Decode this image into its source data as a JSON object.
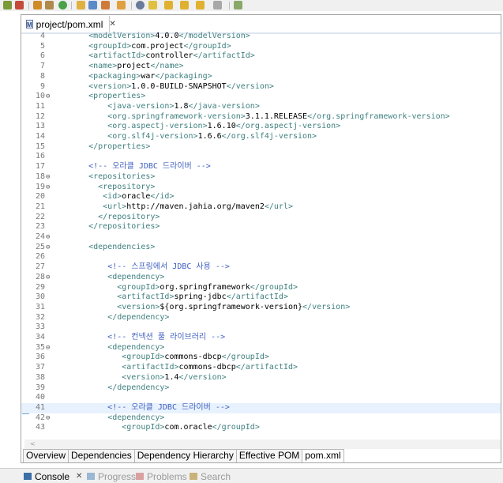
{
  "editor": {
    "tab_label": "project/pom.xml",
    "tab_close": "✕",
    "file_icon_glyph": "M"
  },
  "code_lines": [
    {
      "n": "4",
      "fold": "",
      "parts": [
        {
          "k": "t",
          "s": "<modelVersion>"
        },
        {
          "k": "x",
          "s": "4.0.0"
        },
        {
          "k": "t",
          "s": "</modelVersion>"
        }
      ],
      "indent": "    "
    },
    {
      "n": "5",
      "fold": "",
      "parts": [
        {
          "k": "t",
          "s": "<groupId>"
        },
        {
          "k": "x",
          "s": "com.project"
        },
        {
          "k": "t",
          "s": "</groupId>"
        }
      ],
      "indent": "    "
    },
    {
      "n": "6",
      "fold": "",
      "parts": [
        {
          "k": "t",
          "s": "<artifactId>"
        },
        {
          "k": "x",
          "s": "controller"
        },
        {
          "k": "t",
          "s": "</artifactId>"
        }
      ],
      "indent": "    "
    },
    {
      "n": "7",
      "fold": "",
      "parts": [
        {
          "k": "t",
          "s": "<name>"
        },
        {
          "k": "x",
          "s": "project"
        },
        {
          "k": "t",
          "s": "</name>"
        }
      ],
      "indent": "    "
    },
    {
      "n": "8",
      "fold": "",
      "parts": [
        {
          "k": "t",
          "s": "<packaging>"
        },
        {
          "k": "x",
          "s": "war"
        },
        {
          "k": "t",
          "s": "</packaging>"
        }
      ],
      "indent": "    "
    },
    {
      "n": "9",
      "fold": "",
      "parts": [
        {
          "k": "t",
          "s": "<version>"
        },
        {
          "k": "x",
          "s": "1.0.0-BUILD-SNAPSHOT"
        },
        {
          "k": "t",
          "s": "</version>"
        }
      ],
      "indent": "    "
    },
    {
      "n": "10",
      "fold": "⊖",
      "parts": [
        {
          "k": "t",
          "s": "<properties>"
        }
      ],
      "indent": "    "
    },
    {
      "n": "11",
      "fold": "",
      "parts": [
        {
          "k": "t",
          "s": "<java-version>"
        },
        {
          "k": "x",
          "s": "1.8"
        },
        {
          "k": "t",
          "s": "</java-version>"
        }
      ],
      "indent": "        "
    },
    {
      "n": "12",
      "fold": "",
      "parts": [
        {
          "k": "t",
          "s": "<org.springframework-version>"
        },
        {
          "k": "x",
          "s": "3.1.1.RELEASE"
        },
        {
          "k": "t",
          "s": "</org.springframework-version>"
        }
      ],
      "indent": "        "
    },
    {
      "n": "13",
      "fold": "",
      "parts": [
        {
          "k": "t",
          "s": "<org.aspectj-version>"
        },
        {
          "k": "x",
          "s": "1.6.10"
        },
        {
          "k": "t",
          "s": "</org.aspectj-version>"
        }
      ],
      "indent": "        "
    },
    {
      "n": "14",
      "fold": "",
      "parts": [
        {
          "k": "t",
          "s": "<org.slf4j-version>"
        },
        {
          "k": "x",
          "s": "1.6.6"
        },
        {
          "k": "t",
          "s": "</org.slf4j-version>"
        }
      ],
      "indent": "        "
    },
    {
      "n": "15",
      "fold": "",
      "parts": [
        {
          "k": "t",
          "s": "</properties>"
        }
      ],
      "indent": "    "
    },
    {
      "n": "16",
      "fold": "",
      "parts": [],
      "indent": ""
    },
    {
      "n": "17",
      "fold": "",
      "parts": [
        {
          "k": "c",
          "s": "<!-- 오라클 JDBC 드라이버 -->"
        }
      ],
      "indent": "    "
    },
    {
      "n": "18",
      "fold": "⊖",
      "parts": [
        {
          "k": "t",
          "s": "<repositories>"
        }
      ],
      "indent": "    "
    },
    {
      "n": "19",
      "fold": "⊖",
      "parts": [
        {
          "k": "t",
          "s": "<repository>"
        }
      ],
      "indent": "      "
    },
    {
      "n": "20",
      "fold": "",
      "parts": [
        {
          "k": "t",
          "s": "<id>"
        },
        {
          "k": "x",
          "s": "oracle"
        },
        {
          "k": "t",
          "s": "</id>"
        }
      ],
      "indent": "       "
    },
    {
      "n": "21",
      "fold": "",
      "parts": [
        {
          "k": "t",
          "s": "<url>"
        },
        {
          "k": "x",
          "s": "http://maven.jahia.org/maven2"
        },
        {
          "k": "t",
          "s": "</url>"
        }
      ],
      "indent": "       "
    },
    {
      "n": "22",
      "fold": "",
      "parts": [
        {
          "k": "t",
          "s": "</repository>"
        }
      ],
      "indent": "      "
    },
    {
      "n": "23",
      "fold": "",
      "parts": [
        {
          "k": "t",
          "s": "</repositories>"
        }
      ],
      "indent": "    "
    },
    {
      "n": "24",
      "fold": "⊖",
      "parts": [],
      "indent": ""
    },
    {
      "n": "25",
      "fold": "⊖",
      "parts": [
        {
          "k": "t",
          "s": "<dependencies>"
        }
      ],
      "indent": "    "
    },
    {
      "n": "26",
      "fold": "",
      "parts": [],
      "indent": ""
    },
    {
      "n": "27",
      "fold": "",
      "parts": [
        {
          "k": "c",
          "s": "<!-- 스프링에서 JDBC 사용 -->"
        }
      ],
      "indent": "        "
    },
    {
      "n": "28",
      "fold": "⊖",
      "parts": [
        {
          "k": "t",
          "s": "<dependency>"
        }
      ],
      "indent": "        "
    },
    {
      "n": "29",
      "fold": "",
      "parts": [
        {
          "k": "t",
          "s": "<groupId>"
        },
        {
          "k": "x",
          "s": "org.springframework"
        },
        {
          "k": "t",
          "s": "</groupId>"
        }
      ],
      "indent": "          "
    },
    {
      "n": "30",
      "fold": "",
      "parts": [
        {
          "k": "t",
          "s": "<artifactId>"
        },
        {
          "k": "x",
          "s": "spring-jdbc"
        },
        {
          "k": "t",
          "s": "</artifactId>"
        }
      ],
      "indent": "          "
    },
    {
      "n": "31",
      "fold": "",
      "parts": [
        {
          "k": "t",
          "s": "<version>"
        },
        {
          "k": "x",
          "s": "${org.springframework-version}"
        },
        {
          "k": "t",
          "s": "</version>"
        }
      ],
      "indent": "          "
    },
    {
      "n": "32",
      "fold": "",
      "parts": [
        {
          "k": "t",
          "s": "</dependency>"
        }
      ],
      "indent": "        "
    },
    {
      "n": "33",
      "fold": "",
      "parts": [],
      "indent": ""
    },
    {
      "n": "34",
      "fold": "",
      "parts": [
        {
          "k": "c",
          "s": "<!-- 컨넥션 풀 라이브러리 -->"
        }
      ],
      "indent": "        "
    },
    {
      "n": "35",
      "fold": "⊖",
      "parts": [
        {
          "k": "t",
          "s": "<dependency>"
        }
      ],
      "indent": "        "
    },
    {
      "n": "36",
      "fold": "",
      "parts": [
        {
          "k": "t",
          "s": "<groupId>"
        },
        {
          "k": "x",
          "s": "commons-dbcp"
        },
        {
          "k": "t",
          "s": "</groupId>"
        }
      ],
      "indent": "           "
    },
    {
      "n": "37",
      "fold": "",
      "parts": [
        {
          "k": "t",
          "s": "<artifactId>"
        },
        {
          "k": "x",
          "s": "commons-dbcp"
        },
        {
          "k": "t",
          "s": "</artifactId>"
        }
      ],
      "indent": "           "
    },
    {
      "n": "38",
      "fold": "",
      "parts": [
        {
          "k": "t",
          "s": "<version>"
        },
        {
          "k": "x",
          "s": "1.4"
        },
        {
          "k": "t",
          "s": "</version>"
        }
      ],
      "indent": "           "
    },
    {
      "n": "39",
      "fold": "",
      "parts": [
        {
          "k": "t",
          "s": "</dependency>"
        }
      ],
      "indent": "        "
    },
    {
      "n": "40",
      "fold": "",
      "parts": [],
      "indent": ""
    },
    {
      "n": "41",
      "fold": "",
      "parts": [
        {
          "k": "c",
          "s": "<!-- 오라클 JDBC 드라이버 -->"
        }
      ],
      "indent": "        ",
      "highlight": true
    },
    {
      "n": "42",
      "fold": "⊖",
      "parts": [
        {
          "k": "t",
          "s": "<dependency>"
        }
      ],
      "indent": "        "
    },
    {
      "n": "43",
      "fold": "",
      "parts": [
        {
          "k": "t",
          "s": "<groupId>"
        },
        {
          "k": "x",
          "s": "com.oracle"
        },
        {
          "k": "t",
          "s": "</groupId>"
        }
      ],
      "indent": "           "
    }
  ],
  "bottom_tabs": [
    {
      "label": "Overview",
      "active": false
    },
    {
      "label": "Dependencies",
      "active": false
    },
    {
      "label": "Dependency Hierarchy",
      "active": false
    },
    {
      "label": "Effective POM",
      "active": false
    },
    {
      "label": "pom.xml",
      "active": true
    }
  ],
  "console_tabs": [
    {
      "label": "Console",
      "close": "✕",
      "enabled": true,
      "icon_color": "#3a6ea5"
    },
    {
      "label": "Progress",
      "enabled": false,
      "icon_color": "#9ab7d3"
    },
    {
      "label": "Problems",
      "enabled": false,
      "icon_color": "#d9a1a1"
    },
    {
      "label": "Search",
      "enabled": false,
      "icon_color": "#c9b37a"
    }
  ],
  "scroll_arrow": "<"
}
